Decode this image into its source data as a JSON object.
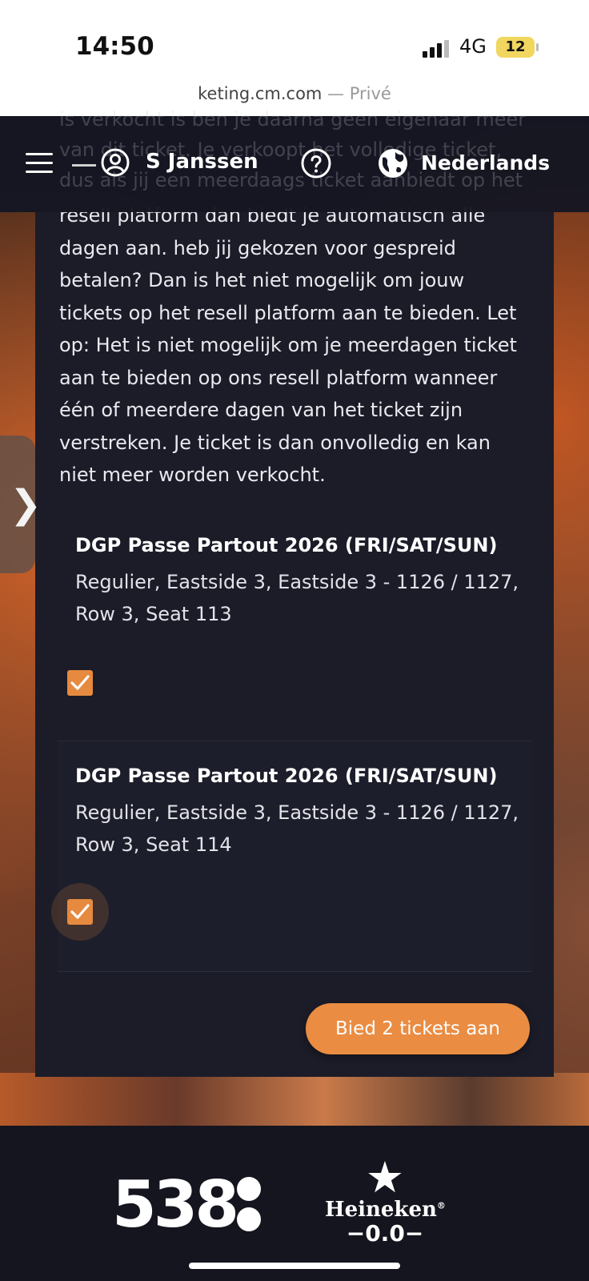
{
  "status": {
    "time": "14:50",
    "network": "4G",
    "battery": "12"
  },
  "browser": {
    "url": "keting.cm.com",
    "mode": "— Privé"
  },
  "nav": {
    "user_name": "S Janssen",
    "language": "Nederlands"
  },
  "ghost_text": "is verkocht is ben je daarna geen eigenaar meer van dit ticket. Je verkoopt het volledige ticket, dus als jij een meerdaags ticket aanbiedt op het",
  "main": {
    "body_text": "resell platform dan biedt je automatisch alle dagen aan. heb jij gekozen voor gespreid betalen? Dan is het niet mogelijk om jouw tickets op het resell platform aan te bieden. Let op: Het is niet mogelijk om je meerdagen ticket aan te bieden op ons resell platform wanneer één of meerdere dagen van het ticket zijn verstreken. Je ticket is dan onvolledig en kan niet meer worden verkocht.",
    "tickets": [
      {
        "title": "DGP Passe Partout 2026 (FRI/SAT/SUN)",
        "description": "Regulier, Eastside 3, Eastside 3 - 1126 / 1127, Row 3, Seat 113",
        "checked": true
      },
      {
        "title": "DGP Passe Partout 2026 (FRI/SAT/SUN)",
        "description": "Regulier, Eastside 3, Eastside 3 - 1126 / 1127, Row 3, Seat 114",
        "checked": true
      }
    ],
    "offer_button": "Bied 2 tickets aan"
  },
  "side_handle": {
    "glyph": "❯"
  },
  "footer": {
    "sponsor1": "538",
    "sponsor2_brand": "Heineken",
    "sponsor2_sub": "−0.0−",
    "sponsor2_reg": "®"
  },
  "colors": {
    "accent": "#ea8c42",
    "card": "#1b1c28",
    "nav": "#141622"
  }
}
